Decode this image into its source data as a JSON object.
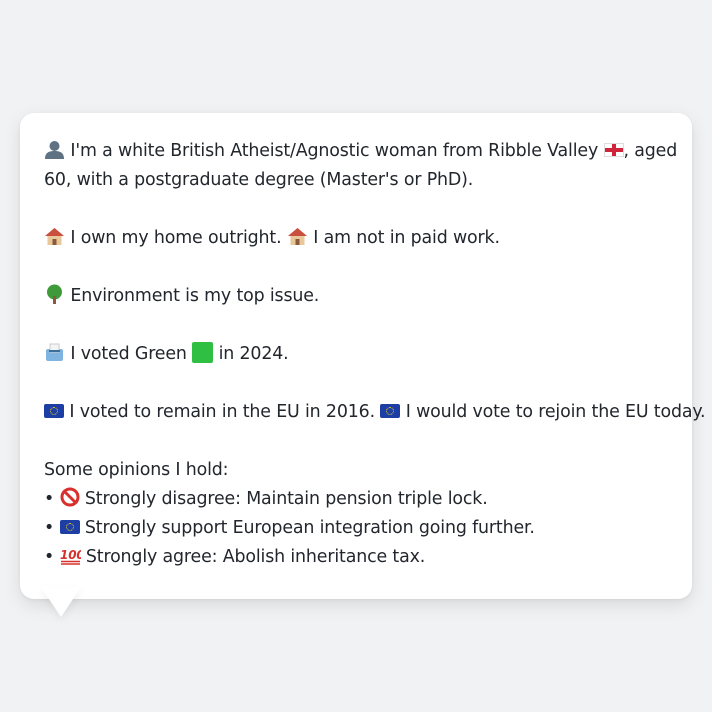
{
  "bubble": {
    "line1": {
      "icon": "person-silhouette-icon",
      "text_a": "I'm a white British Atheist/Agnostic woman from Ribble Valley",
      "flag": "england-flag-icon",
      "text_b": ", aged"
    },
    "line2": "60, with a postgraduate degree (Master's or PhD).",
    "home": {
      "icon": "house-icon",
      "text_a": "I own my home outright.",
      "text_b": "I am not in paid work."
    },
    "issue": {
      "icon": "tree-icon",
      "text": "Environment is my top issue."
    },
    "vote": {
      "icon": "ballot-box-icon",
      "text_a": "I voted Green",
      "party_color": "#2fbf42",
      "text_b": "in 2024."
    },
    "eu": {
      "icon": "eu-flag-icon",
      "text_a": "I voted to remain in the EU in 2016.",
      "text_b": "I would vote to rejoin the EU today."
    },
    "opinions_heading": "Some opinions I hold:",
    "opinions": [
      {
        "bullet": "•",
        "icon": "prohibited-icon",
        "text": "Strongly disagree: Maintain pension triple lock."
      },
      {
        "bullet": "•",
        "icon": "eu-flag-icon",
        "text": "Strongly support European integration going further."
      },
      {
        "bullet": "•",
        "icon": "hundred-points-icon",
        "text": "Strongly agree: Abolish inheritance tax."
      }
    ]
  }
}
